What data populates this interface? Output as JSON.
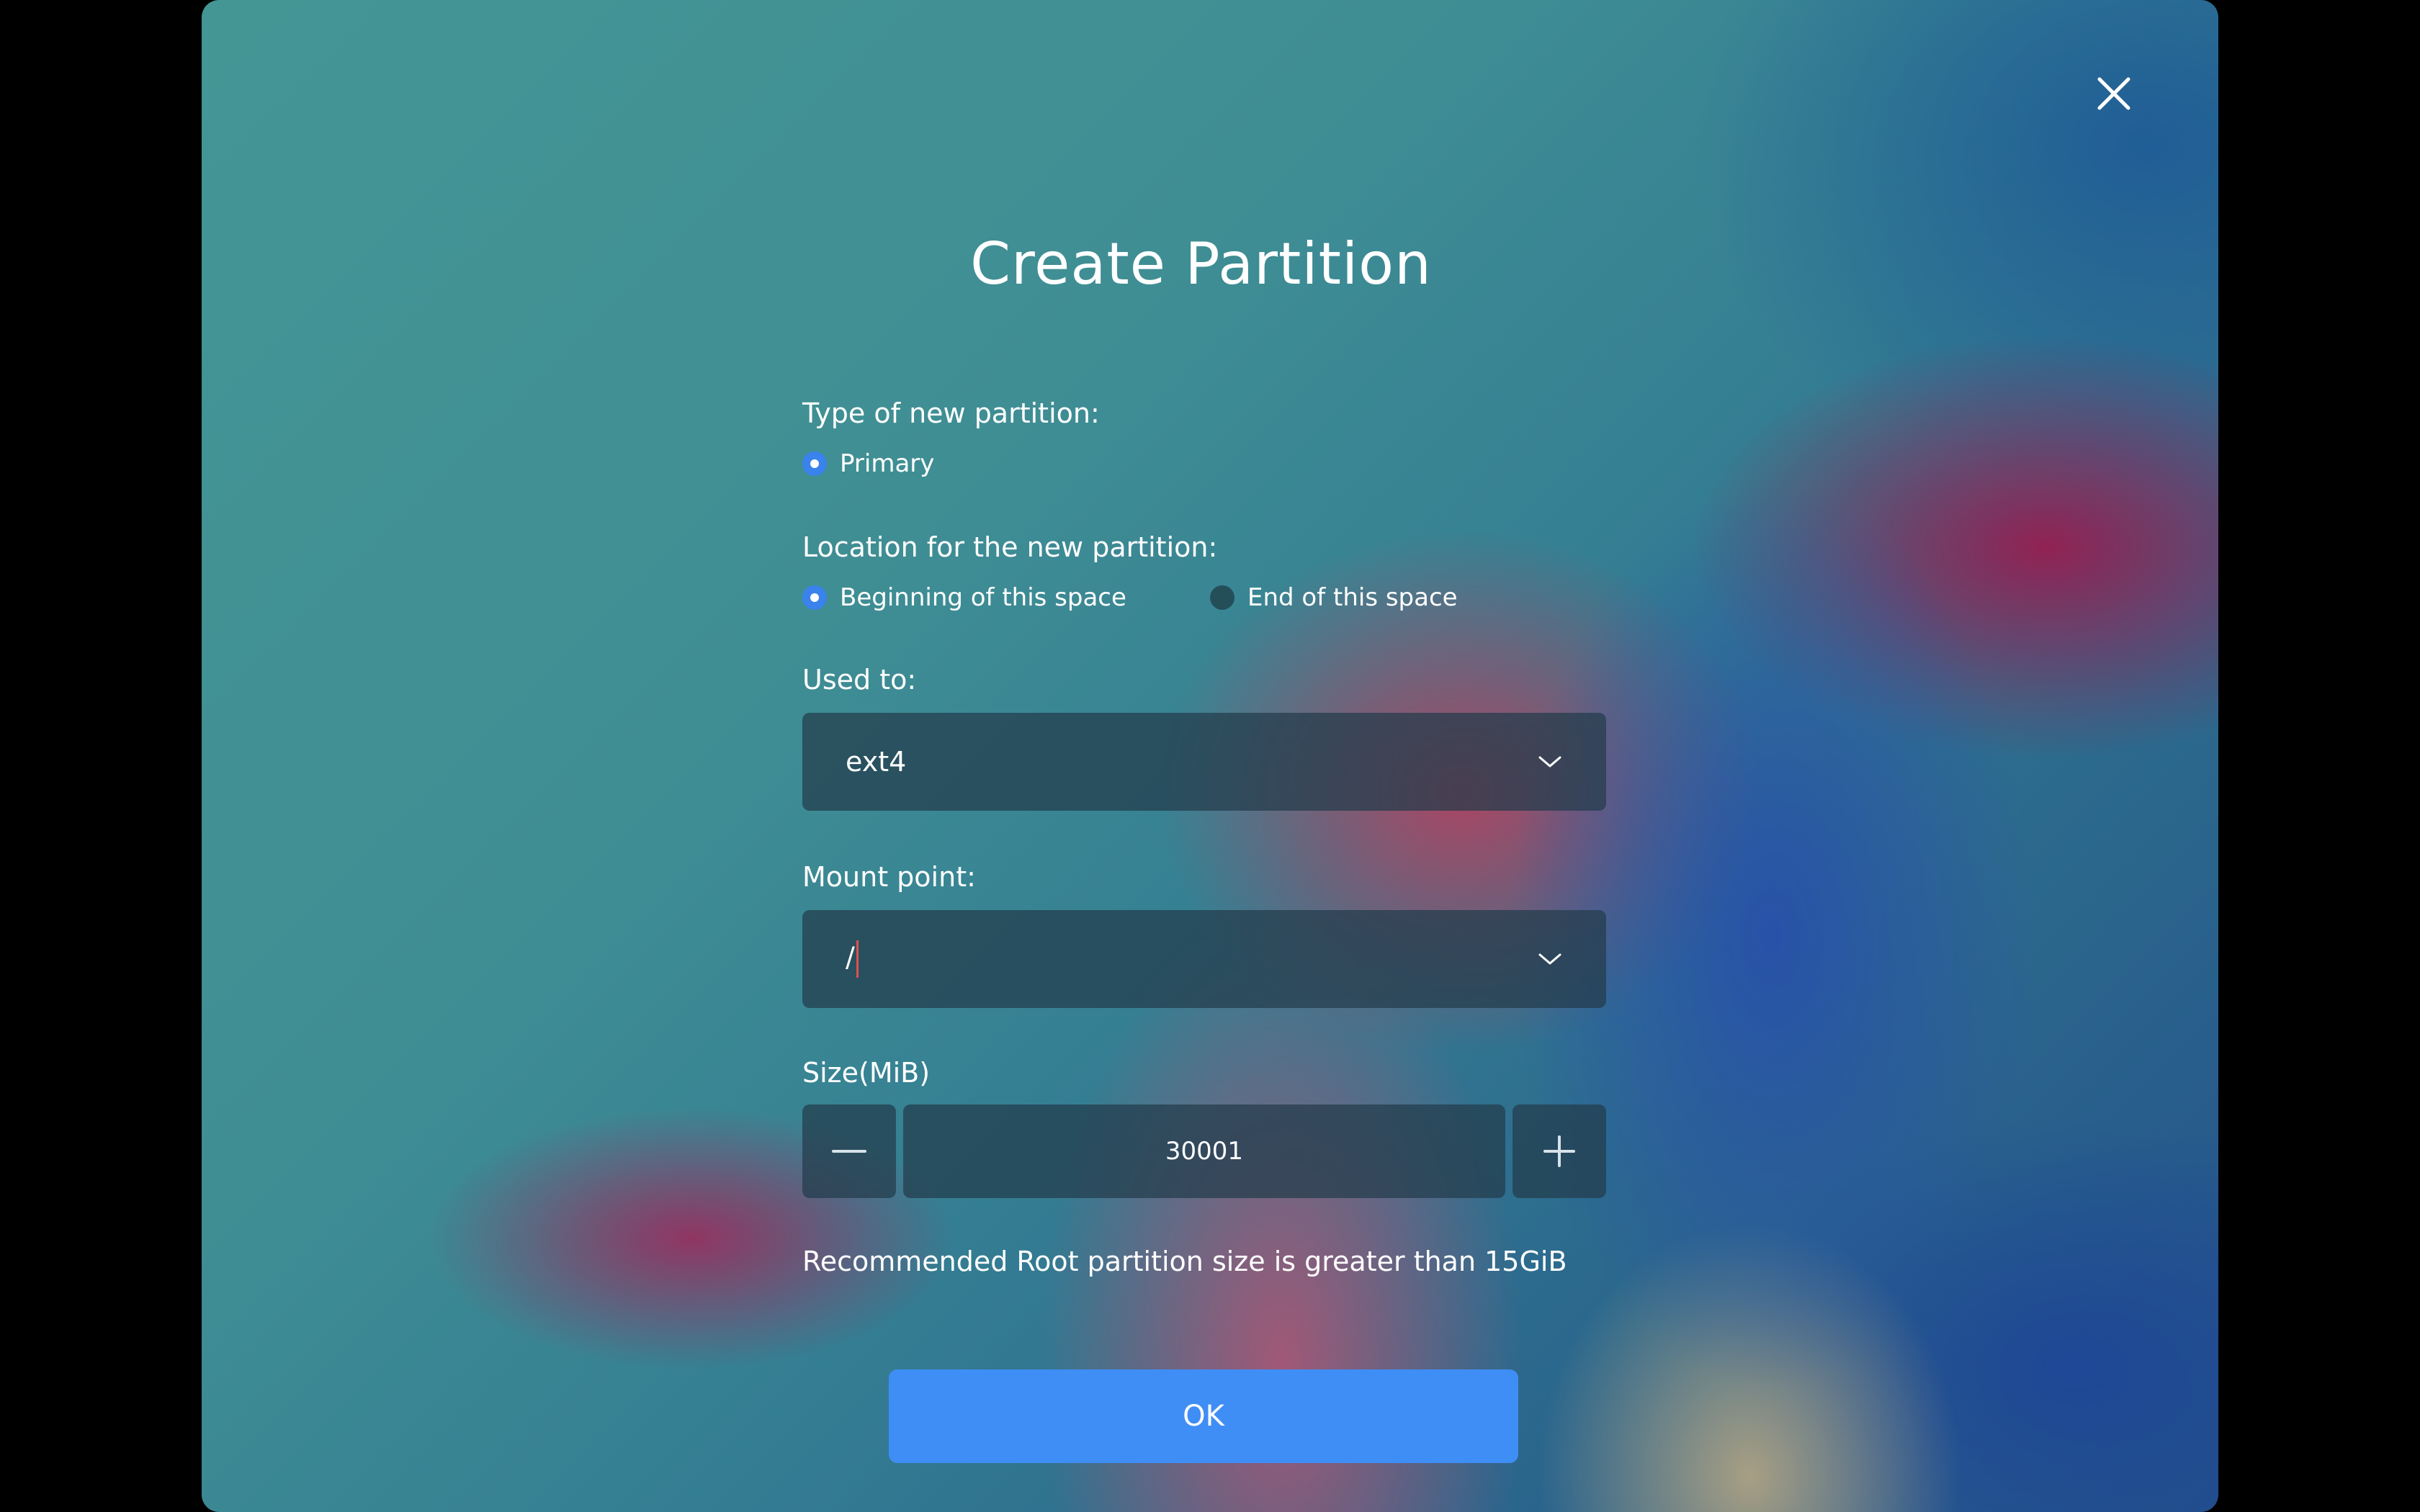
{
  "dialog": {
    "title": "Create Partition"
  },
  "type_section": {
    "label": "Type of new partition:",
    "options": [
      {
        "label": "Primary",
        "selected": true
      }
    ]
  },
  "location_section": {
    "label": "Location for the new partition:",
    "options": [
      {
        "label": "Beginning of this space",
        "selected": true
      },
      {
        "label": "End of this space",
        "selected": false
      }
    ]
  },
  "used_to": {
    "label": "Used to:",
    "value": "ext4"
  },
  "mount_point": {
    "label": "Mount point:",
    "value": "/"
  },
  "size": {
    "label": "Size(MiB)",
    "value": "30001"
  },
  "hint": "Recommended Root partition size is greater than 15GiB",
  "ok_label": "OK",
  "icons": {
    "close": "close-icon",
    "dropdown": "chevron-down-icon",
    "decrement": "minus-icon",
    "increment": "plus-icon"
  },
  "colors": {
    "accent": "#3f8ef5",
    "radio_selected": "#3a82ec",
    "text": "#ffffff"
  }
}
